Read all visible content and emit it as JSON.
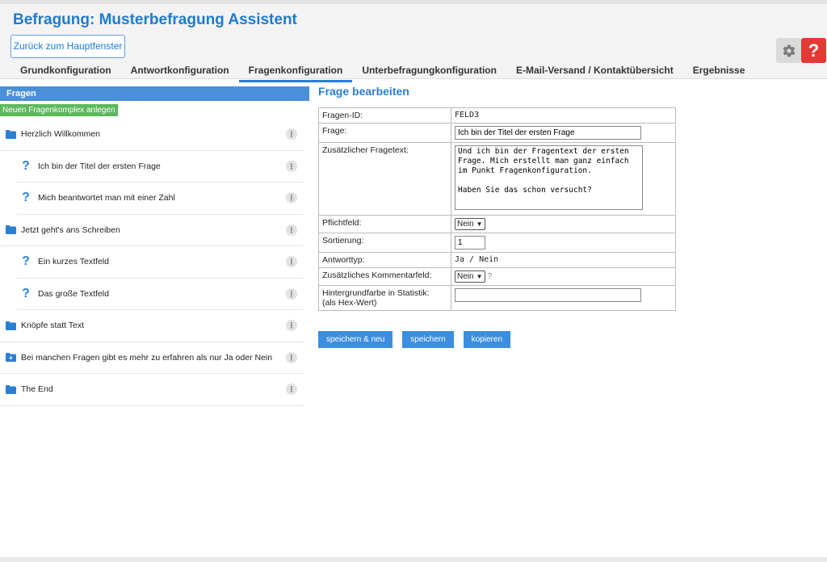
{
  "app": {
    "title": "Befragung: Musterbefragung Assistent",
    "back_label": "Zurück zum Hauptfenster"
  },
  "tabs": [
    {
      "label": "Grundkonfiguration"
    },
    {
      "label": "Antwortkonfiguration"
    },
    {
      "label": "Fragenkonfiguration"
    },
    {
      "label": "Unterbefragungkonfiguration"
    },
    {
      "label": "E-Mail-Versand / Kontaktübersicht"
    },
    {
      "label": "Ergebnisse"
    }
  ],
  "active_tab": "Fragenkonfiguration",
  "toolbar": {
    "settings_icon": "gear-icon",
    "help_label": "?"
  },
  "left_panel": {
    "header": "Fragen",
    "new_complex_label": "Neuen Fragenkomplex anlegen",
    "items": [
      {
        "type": "folder",
        "label": "Herzlich Willkommen",
        "icon": "folder-icon"
      },
      {
        "type": "question",
        "label": "Ich bin der Titel der ersten Frage",
        "icon": "question-icon"
      },
      {
        "type": "question",
        "label": "Mich beantwortet man mit einer Zahl",
        "icon": "question-icon"
      },
      {
        "type": "folder",
        "label": "Jetzt geht's ans Schreiben",
        "icon": "folder-icon"
      },
      {
        "type": "question",
        "label": "Ein kurzes Textfeld",
        "icon": "question-icon"
      },
      {
        "type": "question",
        "label": "Das große Textfeld",
        "icon": "question-icon"
      },
      {
        "type": "folder",
        "label": "Knöpfe statt Text",
        "icon": "folder-icon"
      },
      {
        "type": "folder",
        "label": "Bei manchen Fragen gibt es mehr zu erfahren als nur Ja oder Nein",
        "icon": "folder-plus-icon"
      },
      {
        "type": "folder",
        "label": "The End",
        "icon": "folder-icon"
      }
    ],
    "more_label": "⋮"
  },
  "form": {
    "title": "Frage bearbeiten",
    "id_label": "Fragen-ID:",
    "id_value": "FELD3",
    "question_label": "Frage:",
    "question_value": "Ich bin der Titel der ersten Frage",
    "extra_text_label": "Zusätzlicher Fragetext:",
    "extra_text_value": "Und ich bin der Fragentext der ersten Frage. Mich erstellt man ganz einfach im Punkt Fragenkonfiguration.\n\nHaben Sie das schon versucht?",
    "required_label": "Pflichtfeld:",
    "required_value": "Nein",
    "sort_label": "Sortierung:",
    "sort_value": "1",
    "answer_type_label": "Antworttyp:",
    "answer_type_value": "Ja / Nein",
    "comment_label": "Zusätzliches Kommentarfeld:",
    "comment_value": "Nein",
    "comment_hint": "?",
    "bg_color_label_line1": "Hintergrundfarbe in Statistik:",
    "bg_color_label_line2": "(als Hex-Wert)",
    "bg_color_value": ""
  },
  "buttons": {
    "save_new": "speichern & neu",
    "save": "speichern",
    "copy": "kopieren"
  }
}
